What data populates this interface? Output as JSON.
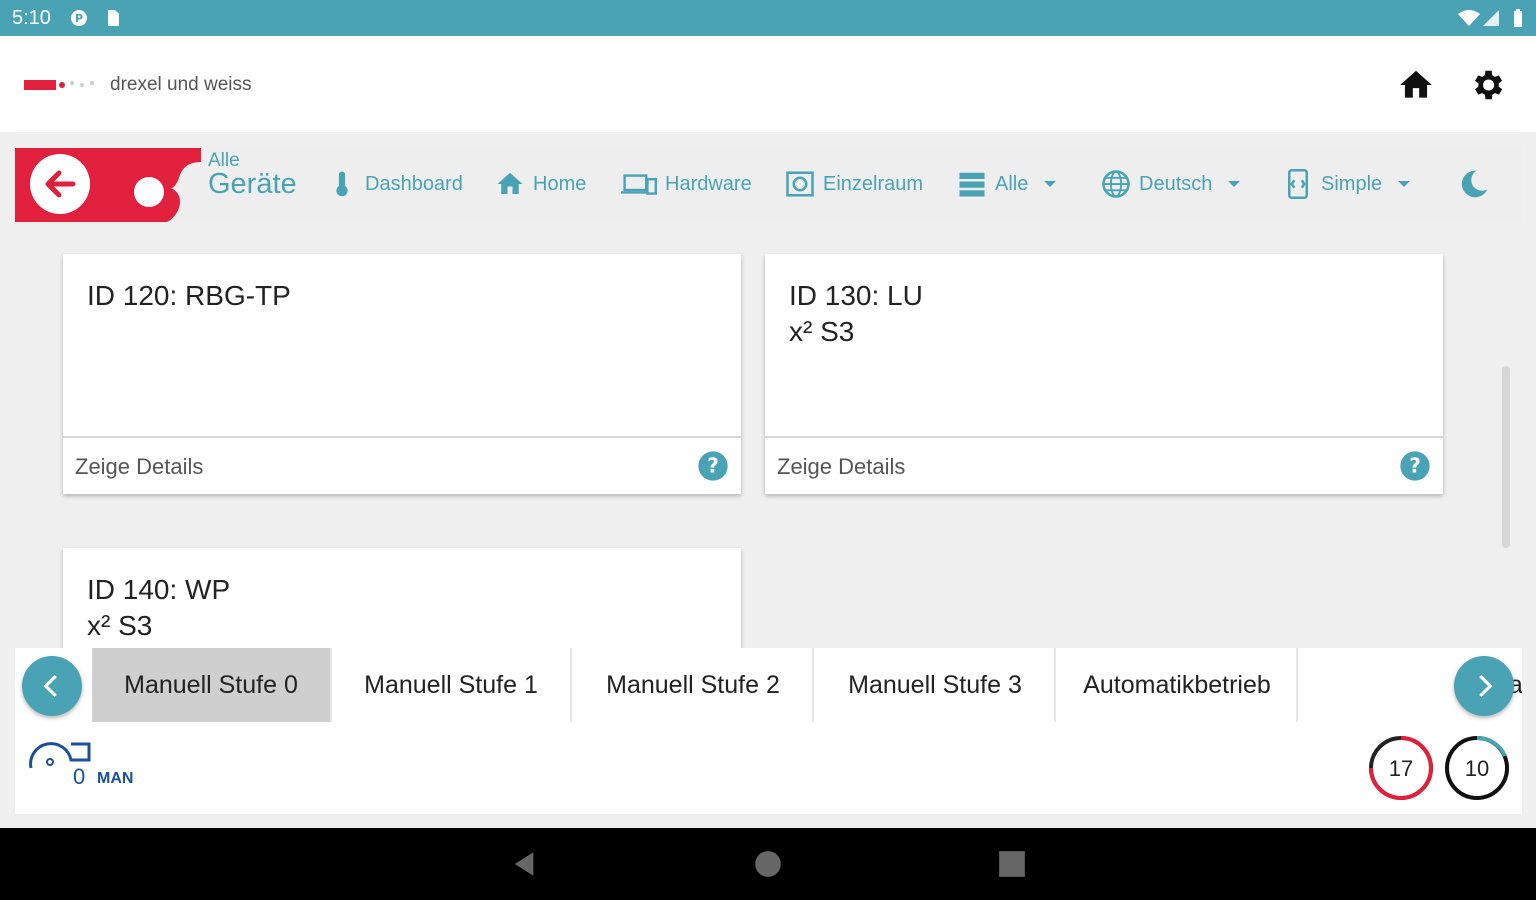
{
  "status": {
    "time": "5:10"
  },
  "header": {
    "brand": "drexel und weiss",
    "home_icon": "home-icon",
    "settings_icon": "gear-icon"
  },
  "nav": {
    "crumb_small": "Alle",
    "crumb_big": "Geräte",
    "items": [
      {
        "label": "Dashboard",
        "icon": "thermometer-icon"
      },
      {
        "label": "Home",
        "icon": "home-icon"
      },
      {
        "label": "Hardware",
        "icon": "devices-icon"
      },
      {
        "label": "Einzelraum",
        "icon": "room-icon"
      },
      {
        "label": "Alle",
        "icon": "list-icon"
      },
      {
        "label": "Deutsch",
        "icon": "globe-icon"
      },
      {
        "label": "Simple",
        "icon": "screen-icon"
      }
    ]
  },
  "cards": [
    {
      "title": "ID 120: RBG-TP",
      "footer": "Zeige Details"
    },
    {
      "title": "ID 130: LU\nx² S3",
      "footer": "Zeige Details"
    },
    {
      "title": "ID 140: WP\nx² S3",
      "footer": ""
    }
  ],
  "modes": [
    {
      "label": "Manuell Stufe 0",
      "active": true
    },
    {
      "label": "Manuell Stufe 1",
      "active": false
    },
    {
      "label": "Manuell Stufe 2",
      "active": false
    },
    {
      "label": "Manuell Stufe 3",
      "active": false
    },
    {
      "label": "Automatikbetrieb",
      "active": false
    },
    {
      "label": "Part",
      "active": false
    }
  ],
  "bottom": {
    "fan_value": "0",
    "fan_mode": "MAN",
    "gauge1": {
      "value": "17",
      "color": "#e0203c"
    },
    "gauge2": {
      "value": "10",
      "color": "#4aa3b5"
    }
  },
  "colors": {
    "accent": "#4aa3b5",
    "brand_red": "#e0203c"
  }
}
